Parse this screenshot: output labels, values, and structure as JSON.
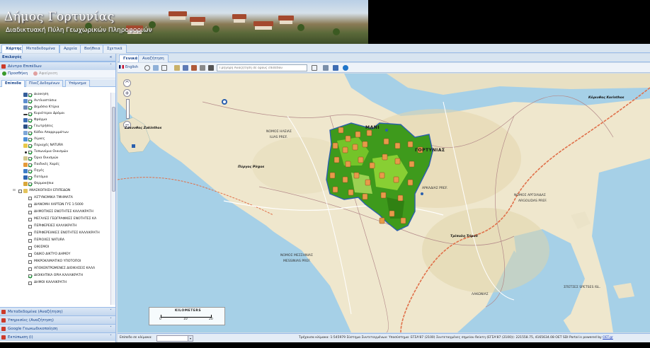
{
  "banner": {
    "title": "Δήμος Γορτυνίας",
    "subtitle": "Διαδικτυακή Πύλη Γεωχωρικών Πληροφοριών"
  },
  "top_tabs": [
    "Χάρτης",
    "Μεταδεδομένα",
    "Αρχεία",
    "Βοήθεια",
    "Σχετικά"
  ],
  "left_panel": {
    "header": "Επιλογές",
    "layers_header": "Δέντρο Επιπέδων",
    "add_button": "Προσθήκη",
    "remove_button": "Αφαίρεση",
    "sub_tabs": [
      "Επίπεδα",
      "Πίνεζ Δεδομένων",
      "Υπόμνημα"
    ],
    "layers": [
      "Διοίκηση",
      "Αντλιοστάσια",
      "Δημόσια Κτίρια",
      "Κυριότεροι Δρόμοι",
      "Φράγμα",
      "Γεωτρήσεις",
      "Κάδοι Απορριμμάτων",
      "Λίμνες",
      "Περιοχές NATURA",
      "Τοπωνύμια Οικισμών",
      "Όρια Οικισμών",
      "Παιδικές Χαρές",
      "Πηγές",
      "Ποτάμια",
      "Θερμοκήπια"
    ],
    "group_label": "ΑΝΑΣΚΟΠΗΣΗ ΕΠΙΠΕΔΩΝ",
    "group_items": [
      "ΑΣΤΥΝΟΜΙΚΑ ΤΜΗΜΑΤΑ",
      "ΔΙΑΝΟΜΗ ΧΑΡΤΩΝ ΓΥΣ 1:5000",
      "ΔΗΜΟΤΙΚΕΣ ΕΝΟΤΗΤΕΣ ΚΑΛΛΙΚΡΑΤΗ",
      "ΜΕΓΑΛΕΣ ΓΕΩΓΡΑΦΙΚΕΣ ΕΝΟΤΗΤΕΣ ΚΑ",
      "ΠΕΡΙΦΕΡΕΙΕΣ ΚΑΛΛΙΚΡΑΤΗ",
      "ΠΕΡΙΦΕΡΕΙΑΚΕΣ ΕΝΟΤΗΤΕΣ ΚΑΛΛΙΚΡΑΤΗ",
      "ΠΕΡΙΟΧΕΣ NATURA",
      "ΟΙΚΙΣΜΟΙ",
      "ΟΔΙΚΟ ΔΙΚΤΥΟ ΔΗΜΟΥ",
      "ΜΙΚΡΟΚΛΙΜΑΤΙΚΟ ΥΠΟΤΟΠΟΙ",
      "ΑΠΟΚΕΝΤΡΩΜΕΝΕΣ ΔΙΟΙΚΗΣΕΙΣ ΚΑΛΛ",
      "ΔΙΟΙΚΗΤΙΚΑ ΟΡΙΑ ΚΑΛΛΙΚΡΑΤΗ",
      "ΔΗΜΟΙ ΚΑΛΛΙΚΡΑΤΗ"
    ],
    "accordion": [
      "Μεταδεδομένα (Αναζήτηση)",
      "Υπηρεσίες (Αναζήτηση)",
      "Google Γεωκωδικοποίηση",
      "Εκτύπωση (i)"
    ]
  },
  "map_tabs": [
    "Γενικά",
    "Αναζήτηση"
  ],
  "toolbar": {
    "language": "English",
    "search_placeholder": "Γρήγορη Αναζήτηση σε όρους επιπέδου"
  },
  "map": {
    "labels": {
      "zakynthos": "Ζάκυνθος Zakinthos",
      "pyrgos": "Πύργος Pirgos",
      "korinthos": "Κόρινθος Korinthos",
      "tripoli": "Τρίπολη Tripoli",
      "nomos_ileias": "ΝΟΜΟΣ ΗΛΕΙΑΣ",
      "ileias_pref": "ILIAS PREF.",
      "nomos_messinias": "ΝΟΜΟΣ ΜΕΣΣΗΝΙΑΣ",
      "messinias_pref": "MESSINIAS PREF.",
      "nomos_argolidas": "ΝΟΜΟΣ ΑΡΓΟΛΙΔΑΣ",
      "argolidas_pref": "ARGOLIDAS PREF.",
      "kythira": "ΣΠΕΤΣΕΣ SPETSES ISL.",
      "mani": "ΜΑΝΙ",
      "gortynias": "ΓΟΡΤΥΝΙΑΣ",
      "arkadias": "ΑΡΚΑΔΙΑΣ PREF.",
      "lakonias": "ΛΑΚΩΝΙΑΣ"
    },
    "scale_title": "KILOMETERS",
    "scale_ticks": [
      "0",
      "10",
      "20"
    ]
  },
  "status": {
    "scale_label": "Επίπεδο σε κλίμακα:",
    "info": "Τρέχουσα κλίμακα: 1:545979  Σύστημα Συντεταγμένων: Υποσύστημα: ΕΓΣΑ'87 (2100)  Συντεταγμένες σημείου δείκτη (ΕΓΣΑ'87 (2100)): 221558.75, 4165634.08  OET SDI Portal is powered by",
    "link": "OET.gr"
  },
  "colors": {
    "header_blue": "#15428b",
    "panel_border": "#99bbe8",
    "sea": "#a6d0e7",
    "land": "#efe7cd",
    "municipality_green": "#3e9a1c",
    "marker_orange": "#e79a4a"
  }
}
